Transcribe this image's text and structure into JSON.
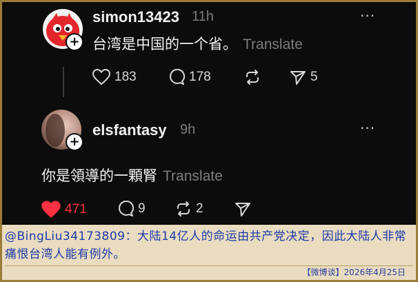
{
  "posts": [
    {
      "username": "simon13423",
      "time": "11h",
      "content": "台湾是中国的一个省。",
      "translate": "Translate",
      "more": "···",
      "likes": "183",
      "comments": "178",
      "shares": "5",
      "liked": false
    },
    {
      "username": "elsfantasy",
      "time": "9h",
      "content": "你是領導的一顆腎",
      "translate": "Translate",
      "more": "···",
      "likes": "471",
      "comments": "9",
      "reposts": "2",
      "liked": true
    }
  ],
  "caption": "@BingLiu34173809：大陆14亿人的命运由共产党决定，因此大陆人非常痛恨台湾人能有例外。",
  "footer": "【微博谈】2026年4月25日",
  "colors": {
    "background": "#0c0c0c",
    "text": "#f2f2f2",
    "muted": "#7d7d7d",
    "like_active": "#ff3040",
    "caption": "#1e3aa8",
    "frame": "#9b7c3a"
  },
  "icons": [
    "heart-icon",
    "comment-icon",
    "repost-icon",
    "share-icon",
    "plus-icon",
    "more-icon"
  ]
}
